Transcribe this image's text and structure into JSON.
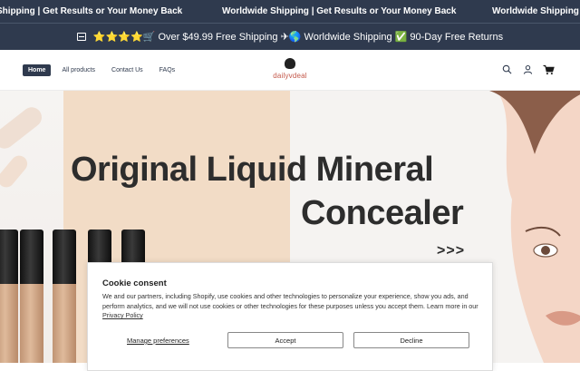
{
  "marquee": {
    "items": [
      "Shipping | Get Results or Your Money Back",
      "Worldwide Shipping | Get Results or Your Money Back",
      "Worldwide Shipping |"
    ]
  },
  "announcement": {
    "icon": "store-icon",
    "text": "⭐⭐⭐⭐🛒 Over $49.99 Free Shipping ✈🌎 Worldwide Shipping ✅ 90-Day Free Returns"
  },
  "header": {
    "nav": [
      {
        "label": "Home",
        "active": true
      },
      {
        "label": "All products"
      },
      {
        "label": "Contact Us"
      },
      {
        "label": "FAQs"
      }
    ],
    "logo_text": "dailyvdeal",
    "icons": [
      "search-icon",
      "account-icon",
      "cart-icon"
    ]
  },
  "hero": {
    "title_line1": "Original Liquid Mineral",
    "title_line2": "Concealer",
    "arrows": ">>>"
  },
  "cookie": {
    "title": "Cookie consent",
    "text": "We and our partners, including Shopify, use cookies and other technologies to personalize your experience, show you ads, and perform analytics, and we will not use cookies or other technologies for these purposes unless you accept them. Learn more in our",
    "privacy_link": "Privacy Policy",
    "manage_label": "Manage preferences",
    "accept_label": "Accept",
    "decline_label": "Decline"
  },
  "colors": {
    "dark_navy": "#2f3a4e",
    "logo_accent": "#c4584a"
  }
}
